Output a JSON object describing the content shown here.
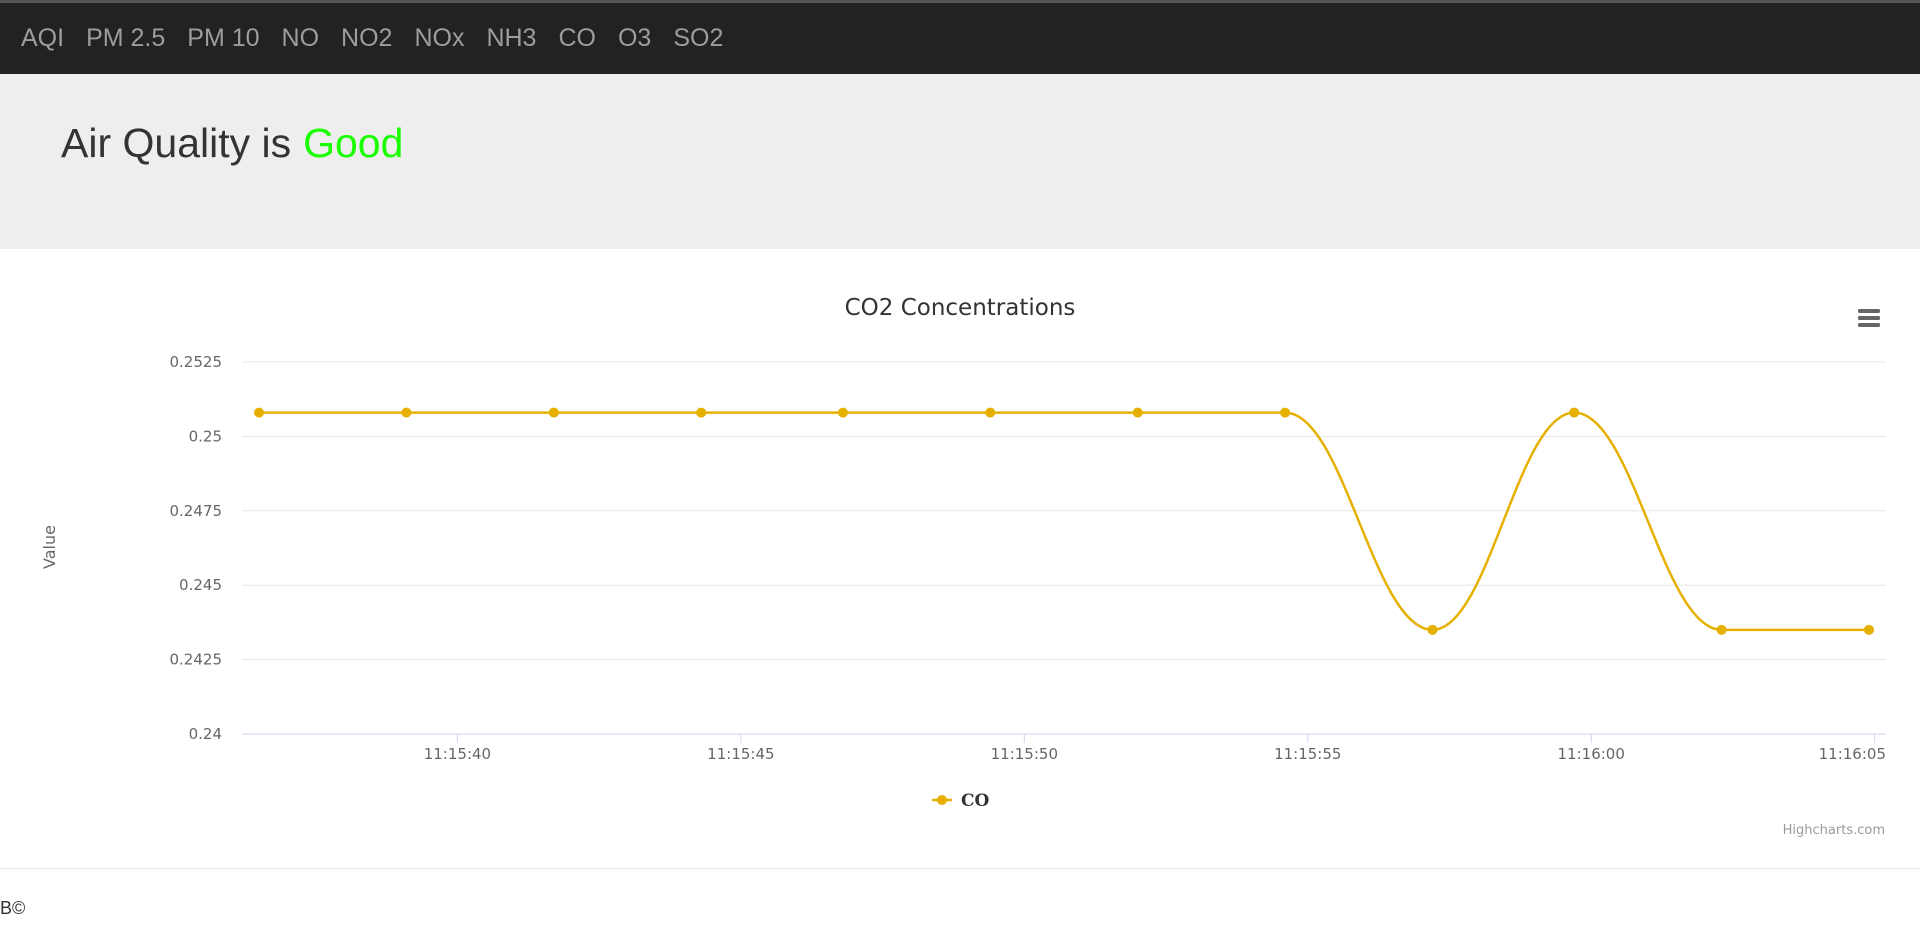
{
  "nav": {
    "items": [
      {
        "label": "AQI"
      },
      {
        "label": "PM 2.5"
      },
      {
        "label": "PM 10"
      },
      {
        "label": "NO"
      },
      {
        "label": "NO2"
      },
      {
        "label": "NOx"
      },
      {
        "label": "NH3"
      },
      {
        "label": "CO"
      },
      {
        "label": "O3"
      },
      {
        "label": "SO2"
      }
    ]
  },
  "banner": {
    "prefix": "Air Quality is",
    "status": "Good",
    "status_color": "#19ff00"
  },
  "menu_icon": "hamburger-menu-icon",
  "credits": "Highcharts.com",
  "footer": {
    "text": "B©"
  },
  "chart_data": {
    "type": "line",
    "title": "CO2 Concentrations",
    "ylabel": "Value",
    "xlabel": "",
    "ylim": [
      0.24,
      0.2525
    ],
    "y_ticks": [
      "0.24",
      "0.2425",
      "0.245",
      "0.2475",
      "0.25",
      "0.2525"
    ],
    "x_ticks": [
      {
        "t": "11:15:40",
        "label": "11:15:40"
      },
      {
        "t": "11:15:45",
        "label": "11:15:45"
      },
      {
        "t": "11:15:50",
        "label": "11:15:50"
      },
      {
        "t": "11:15:55",
        "label": "11:15:55"
      },
      {
        "t": "11:16:00",
        "label": "11:16:00"
      },
      {
        "t": "11:16:05",
        "label": "11:16:05"
      }
    ],
    "x_range": [
      "11:15:36.2",
      "11:16:05.2"
    ],
    "series": [
      {
        "name": "CO",
        "color": "#e6b000",
        "x": [
          "11:15:36.5",
          "11:15:39.1",
          "11:15:41.7",
          "11:15:44.3",
          "11:15:46.8",
          "11:15:49.4",
          "11:15:52.0",
          "11:15:54.6",
          "11:15:57.2",
          "11:15:59.7",
          "11:16:02.3",
          "11:16:04.9"
        ],
        "y": [
          0.2508,
          0.2508,
          0.2508,
          0.2508,
          0.2508,
          0.2508,
          0.2508,
          0.2508,
          0.2435,
          0.2508,
          0.2435,
          0.2435
        ]
      }
    ],
    "legend_position": "bottom-center",
    "grid": true
  }
}
